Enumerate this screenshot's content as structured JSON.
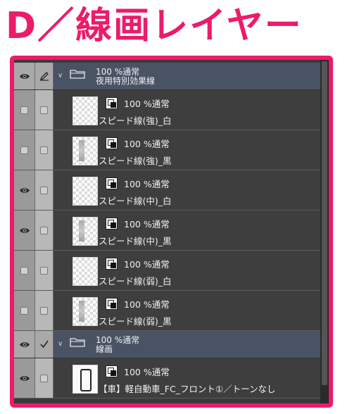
{
  "heading": "D／線画レイヤー",
  "colors": {
    "accent": "#ec1b6b",
    "folder_bg": "#4a5364",
    "layer_bg": "#3e3e3e"
  },
  "layers": [
    {
      "kind": "folder",
      "visible": true,
      "editing": "pen",
      "blend": "100 %通常",
      "name": "夜用特別効果線"
    },
    {
      "kind": "layer",
      "visible": false,
      "blend": "100 %通常",
      "name": "スピード線(強)_白",
      "thumb": "light"
    },
    {
      "kind": "layer",
      "visible": false,
      "blend": "100 %通常",
      "name": "スピード線(強)_黒",
      "thumb": "dark"
    },
    {
      "kind": "layer",
      "visible": true,
      "blend": "100 %通常",
      "name": "スピード線(中)_白",
      "thumb": "light"
    },
    {
      "kind": "layer",
      "visible": true,
      "blend": "100 %通常",
      "name": "スピード線(中)_黒",
      "thumb": "dark"
    },
    {
      "kind": "layer",
      "visible": false,
      "blend": "100 %通常",
      "name": "スピード線(弱)_白",
      "thumb": "light"
    },
    {
      "kind": "layer",
      "visible": false,
      "blend": "100 %通常",
      "name": "スピード線(弱)_黒",
      "thumb": "dark"
    },
    {
      "kind": "folder",
      "visible": true,
      "editing": "check",
      "blend": "100 %通常",
      "name": "線画"
    },
    {
      "kind": "layer",
      "visible": true,
      "blend": "100 %通常",
      "name": "【車】軽自動車_FC_フロント①／トーンなし",
      "thumb": "car"
    }
  ]
}
